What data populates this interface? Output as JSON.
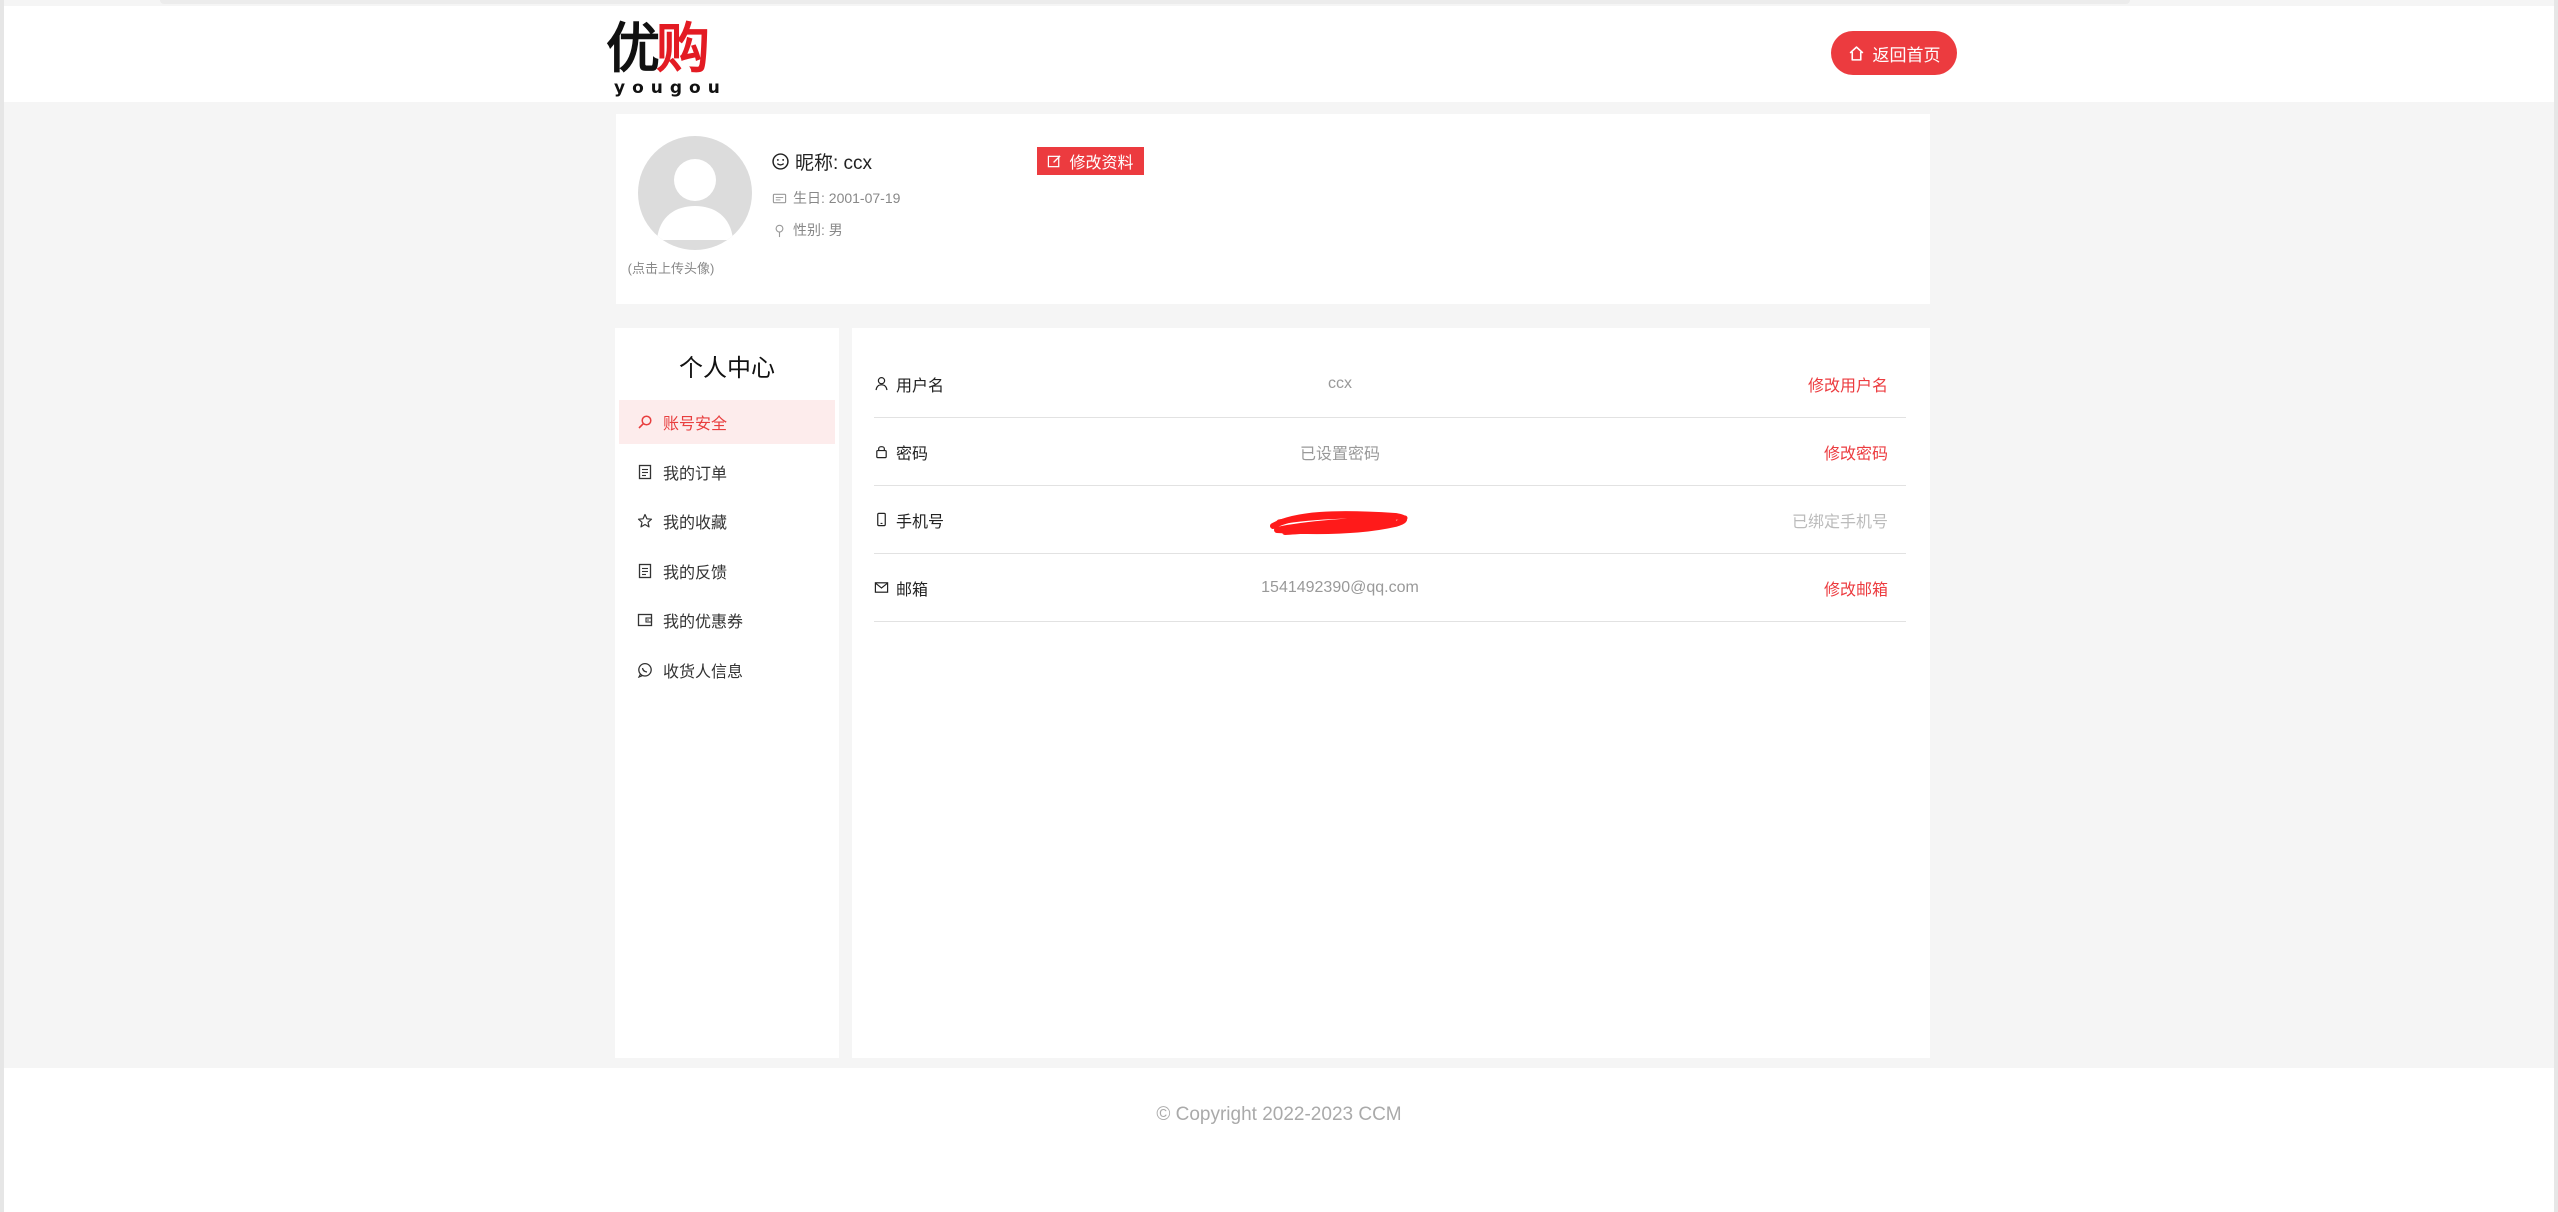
{
  "brand": {
    "cn_part1": "优",
    "cn_part2": "购",
    "en": "yougou"
  },
  "header": {
    "home_button": "返回首页"
  },
  "profile": {
    "nickname": "昵称: ccx",
    "birthday": "生日: 2001-07-19",
    "gender": "性别: 男",
    "avatar_hint": "(点击上传头像)",
    "edit_button": "修改资料"
  },
  "sidebar": {
    "title": "个人中心",
    "items": [
      {
        "label": "账号安全",
        "icon": "search-icon",
        "active": true
      },
      {
        "label": "我的订单",
        "icon": "document-icon",
        "active": false
      },
      {
        "label": "我的收藏",
        "icon": "star-icon",
        "active": false
      },
      {
        "label": "我的反馈",
        "icon": "document-icon",
        "active": false
      },
      {
        "label": "我的优惠券",
        "icon": "wallet-icon",
        "active": false
      },
      {
        "label": "收货人信息",
        "icon": "chat-icon",
        "active": false
      }
    ]
  },
  "account": {
    "rows": [
      {
        "label": "用户名",
        "icon": "user-icon",
        "value": "ccx",
        "action": "修改用户名"
      },
      {
        "label": "密码",
        "icon": "lock-icon",
        "value": "已设置密码",
        "action": "修改密码"
      },
      {
        "label": "手机号",
        "icon": "phone-icon",
        "value": "",
        "action": "已绑定手机号"
      },
      {
        "label": "邮箱",
        "icon": "mail-icon",
        "value": "1541492390@qq.com",
        "action": "修改邮箱"
      }
    ]
  },
  "footer": {
    "copyright": "© Copyright 2022-2023 CCM"
  },
  "colors": {
    "accent": "#ec3b3f",
    "active_bg": "#fdecec",
    "background": "#f5f5f5"
  }
}
